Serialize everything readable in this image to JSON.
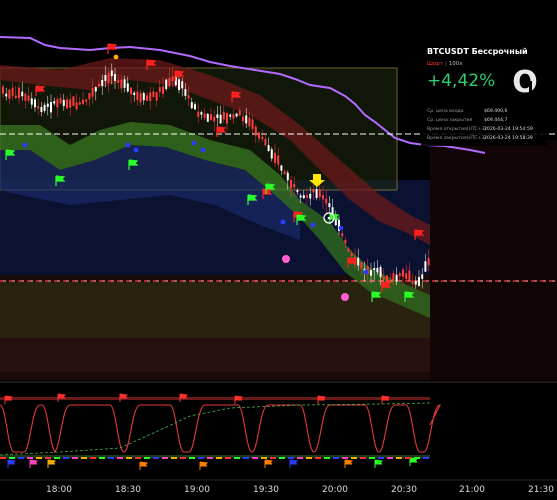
{
  "chart": {
    "x_ticks": [
      "18:00",
      "18:30",
      "19:00",
      "19:30",
      "20:00",
      "20:30",
      "21:00",
      "21:30"
    ],
    "colors": {
      "background": "#000000",
      "candle_up": "#ffffff",
      "candle_down": "#ff3b3b",
      "purple_line": "#b36bff",
      "range_box_border": "#c8b44a",
      "signal_flag_up": "#2aff2a",
      "signal_flag_down": "#ff2020",
      "oscillator_line": "#e23b3b"
    },
    "icons": [
      "signal-flag-icon",
      "yellow-arrow-icon",
      "target-circle-icon"
    ]
  },
  "card": {
    "pair": "BTCUSDT Бессрочный",
    "side": "Шорт",
    "leverage": "100x",
    "pnl": "+4,42%",
    "logo": "O",
    "rows": [
      {
        "label": "Ср. цена входа",
        "value": "$69.490,6"
      },
      {
        "label": "Ср. цена закрытия",
        "value": "$69.444,7"
      },
      {
        "label": "Время открытия(UTC+3)",
        "value": "2026-03-24 19:54:59"
      },
      {
        "label": "Время закрытия(UTC+3)",
        "value": "2026-03-24 19:58:39"
      }
    ]
  }
}
